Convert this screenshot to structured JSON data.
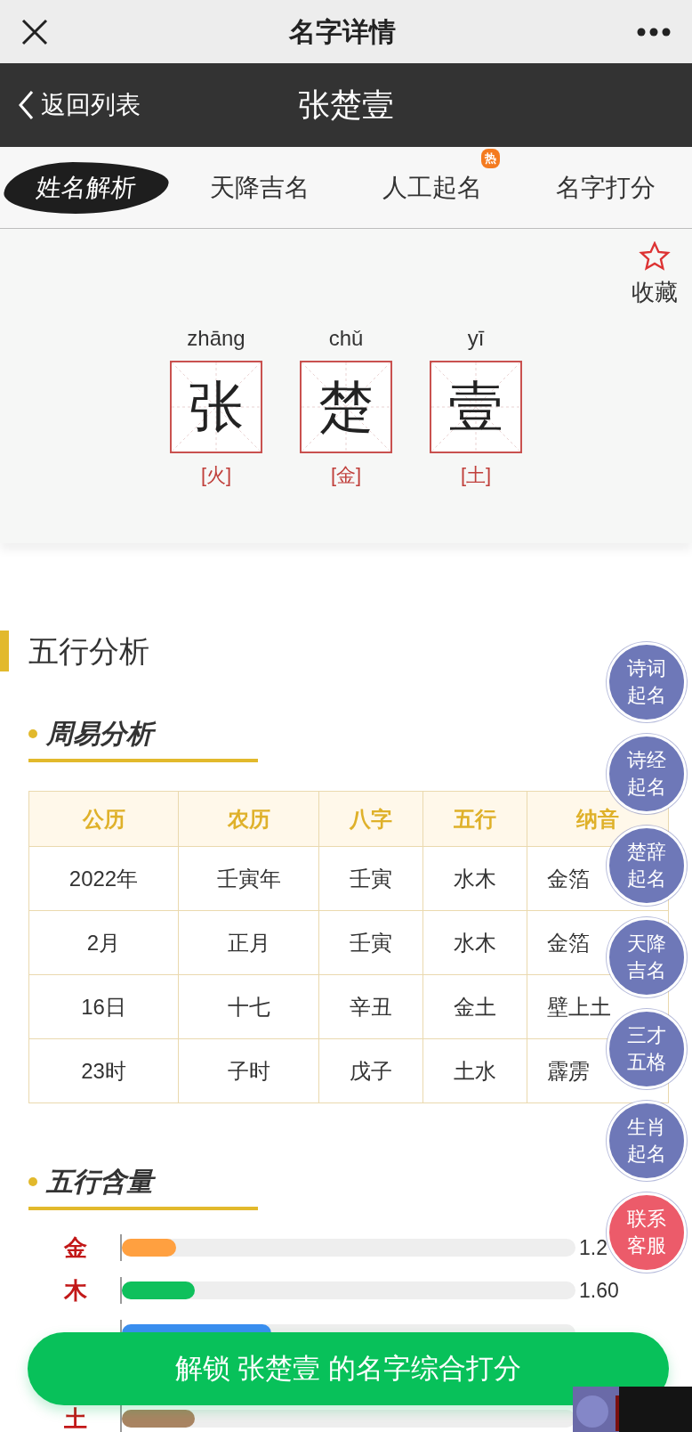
{
  "top_bar": {
    "title": "名字详情"
  },
  "header": {
    "back": "返回列表",
    "title": "张楚壹"
  },
  "tabs": [
    {
      "label": "姓名解析",
      "selected": true
    },
    {
      "label": "天降吉名",
      "selected": false
    },
    {
      "label": "人工起名",
      "selected": false,
      "badge": "热"
    },
    {
      "label": "名字打分",
      "selected": false
    }
  ],
  "hero": {
    "favorite": "收藏",
    "characters": [
      {
        "pinyin": "zhāng",
        "char": "张",
        "element": "[火]"
      },
      {
        "pinyin": "chǔ",
        "char": "楚",
        "element": "[金]"
      },
      {
        "pinyin": "yī",
        "char": "壹",
        "element": "[土]"
      }
    ]
  },
  "section_title": "五行分析",
  "zhouyi": {
    "title": "周易分析",
    "columns": [
      "公历",
      "农历",
      "八字",
      "五行",
      "纳音"
    ],
    "rows": [
      [
        "2022年",
        "壬寅年",
        "壬寅",
        "水木",
        "金箔"
      ],
      [
        "2月",
        "正月",
        "壬寅",
        "水木",
        "金箔"
      ],
      [
        "16日",
        "十七",
        "辛丑",
        "金土",
        "壁上土"
      ],
      [
        "23时",
        "子时",
        "戊子",
        "土水",
        "霹雳"
      ]
    ]
  },
  "content": {
    "title": "五行含量",
    "rows": [
      {
        "label": "金",
        "level": 0.12,
        "color": "#ffa040",
        "value": "1.2"
      },
      {
        "label": "木",
        "level": 0.16,
        "color": "#0fc05c",
        "value": "1.60"
      },
      {
        "level": 0.33,
        "color": "#3a8ef0"
      },
      {
        "label": "土",
        "level": 0.16,
        "color": "#a98462"
      }
    ]
  },
  "float_buttons": [
    {
      "label": "诗词起名",
      "color": "#6e78b8"
    },
    {
      "label": "诗经起名",
      "color": "#6e78b8"
    },
    {
      "label": "楚辞起名",
      "color": "#6e78b8"
    },
    {
      "label": "天降吉名",
      "color": "#6e78b8"
    },
    {
      "label": "三才五格",
      "color": "#6e78b8"
    },
    {
      "label": "生肖起名",
      "color": "#6e78b8"
    },
    {
      "label": "联系客服",
      "color": "#ec5b6a"
    }
  ],
  "cta": "解锁 张楚壹 的名字综合打分"
}
